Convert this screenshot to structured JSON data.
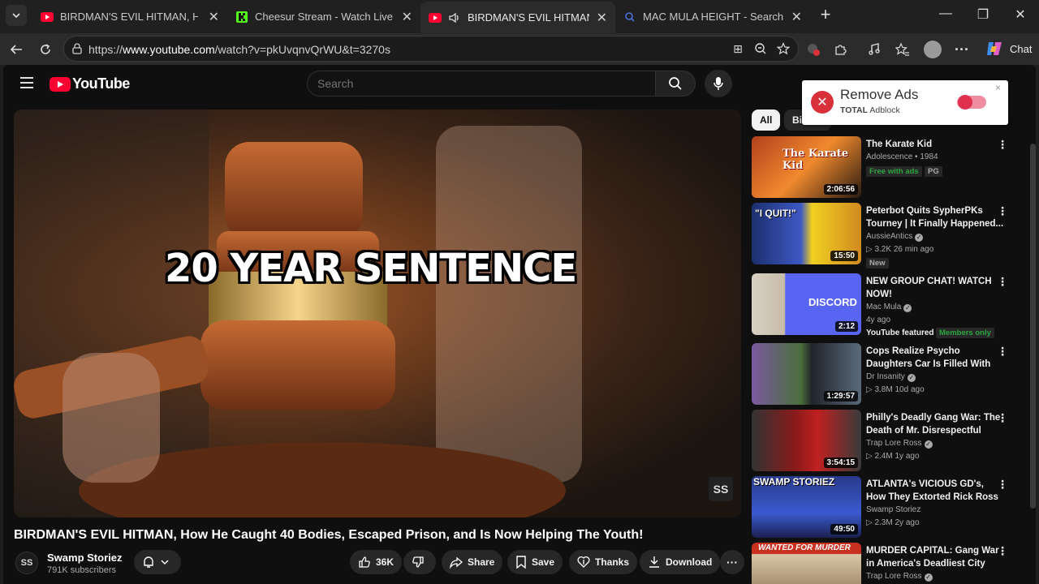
{
  "browser": {
    "tabs": [
      {
        "title": "BIRDMAN'S EVIL HITMAN, How He",
        "active": false
      },
      {
        "title": "Cheesur Stream - Watch Live on K",
        "active": false
      },
      {
        "title": "BIRDMAN'S EVIL HITMAN, He",
        "active": true
      },
      {
        "title": "MAC MULA HEIGHT - Search",
        "active": false
      }
    ],
    "url_prefix": "https://",
    "url_host": "www.youtube.com",
    "url_path": "/watch?v=pkUvqnvQrWU&t=3270s",
    "chat_label": "Chat"
  },
  "youtube": {
    "logo_text": "YouTube",
    "search_placeholder": "Search",
    "video": {
      "overlay_text": "20 YEAR SENTENCE",
      "watermark": "SS",
      "title": "BIRDMAN'S EVIL HITMAN, How He Caught 40 Bodies, Escaped Prison, and Is Now Helping The Youth!",
      "channel": "Swamp Storiez",
      "subscribers": "791K subscribers",
      "likes": "36K",
      "share_label": "Share",
      "save_label": "Save",
      "thanks_label": "Thanks",
      "download_label": "Download"
    },
    "chips": [
      {
        "label": "All",
        "selected": true
      },
      {
        "label": "Bir",
        "selected": false
      }
    ],
    "recommendations": [
      {
        "title": "The Karate Kid",
        "line1": "Adolescence • 1984",
        "line2": "",
        "duration": "2:06:56",
        "badges": [
          "Free with ads",
          "PG"
        ],
        "thumb_text": "The Karate Kid"
      },
      {
        "title": "Peterbot Quits SypherPKs Tourney | It Finally Happened...",
        "line1": "AussieAntics",
        "line2": "▷ 3.2K  26 min ago",
        "duration": "15:50",
        "badges": [
          "New"
        ],
        "thumb_text": "\"I QUIT!\""
      },
      {
        "title": "NEW GROUP CHAT!  WATCH NOW!",
        "line1": "Mac Mula",
        "line2": "4y ago",
        "duration": "2:12",
        "badges": [
          "YouTube featured",
          "Members only"
        ],
        "thumb_text": "DISCORD"
      },
      {
        "title": "Cops Realize Psycho Daughters Car Is Filled With Bodies",
        "line1": "Dr Insanity",
        "line2": "▷ 3.8M  10d ago",
        "duration": "1:29:57",
        "badges": [],
        "thumb_text": ""
      },
      {
        "title": "Philly's Deadly Gang War: The Death of Mr. Disrespectful",
        "line1": "Trap Lore Ross",
        "line2": "▷ 2.4M  1y ago",
        "duration": "3:54:15",
        "badges": [],
        "thumb_text": ""
      },
      {
        "title": "ATLANTA's VICIOUS GD's, How They Extorted Rick Ross for ...",
        "line1": "Swamp Storiez",
        "line2": "▷ 2.3M  2y ago",
        "duration": "49:50",
        "badges": [],
        "thumb_text": "SWAMP STORIEZ"
      },
      {
        "title": "MURDER CAPITAL: Gang War in America's Deadliest City",
        "line1": "Trap Lore Ross",
        "line2": "",
        "duration": "",
        "badges": [],
        "thumb_text": "WANTED FOR MURDER"
      }
    ]
  },
  "adblock_popup": {
    "title": "Remove Ads",
    "brand_bold": "TOTAL",
    "brand_rest": " Adblock",
    "close": "×"
  },
  "colors": {
    "yt_red": "#ff0033",
    "adblock_red": "#d9313a",
    "members_green": "#2ba640"
  }
}
